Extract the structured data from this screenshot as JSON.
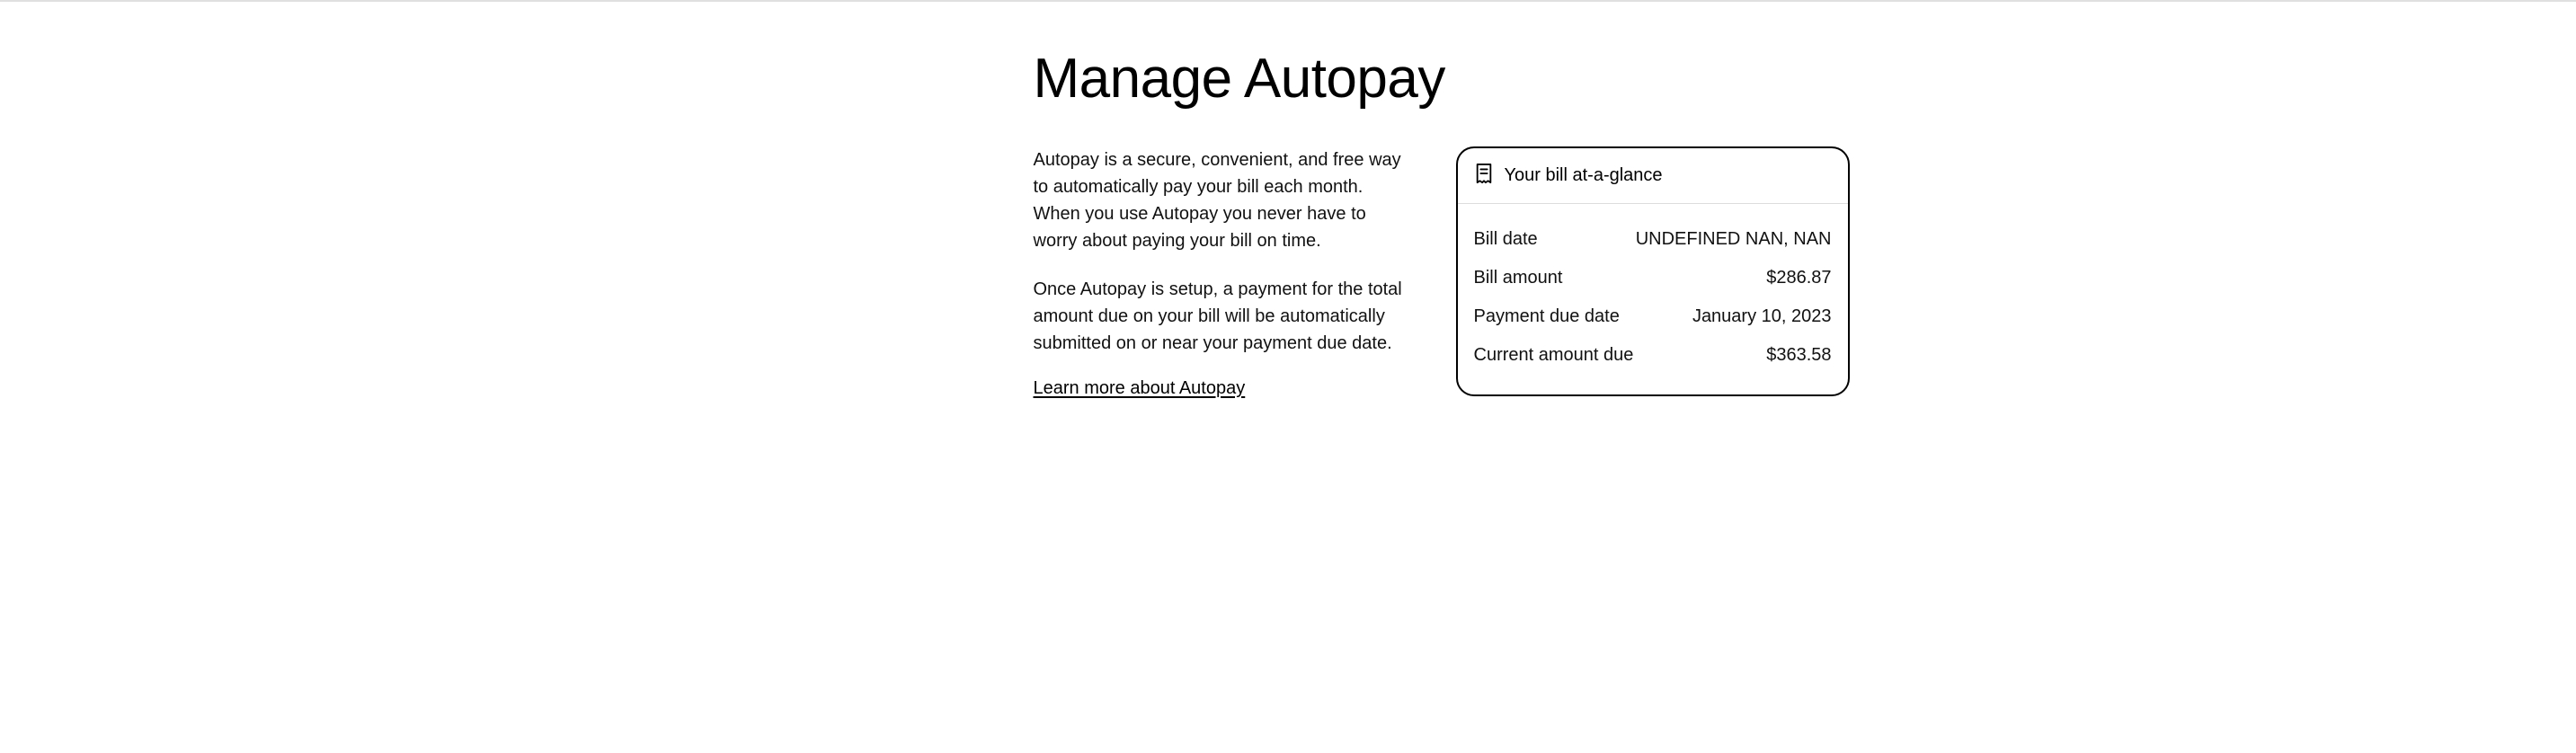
{
  "title": "Manage Autopay",
  "intro": {
    "p1": "Autopay is a secure, convenient, and free way to automatically pay your bill each month. When you use Autopay you never have to worry about paying your bill on time.",
    "p2": "Once Autopay is setup, a payment for the total amount due on your bill will be automatically submitted on or near your payment due date.",
    "learn_more": "Learn more about Autopay"
  },
  "bill_card": {
    "header": "Your bill at-a-glance",
    "rows": {
      "bill_date": {
        "label": "Bill date",
        "value": "UNDEFINED NAN, NAN"
      },
      "bill_amount": {
        "label": "Bill amount",
        "value": "$286.87"
      },
      "payment_due_date": {
        "label": "Payment due date",
        "value": "January 10, 2023"
      },
      "current_amount_due": {
        "label": "Current amount due",
        "value": "$363.58"
      }
    }
  }
}
